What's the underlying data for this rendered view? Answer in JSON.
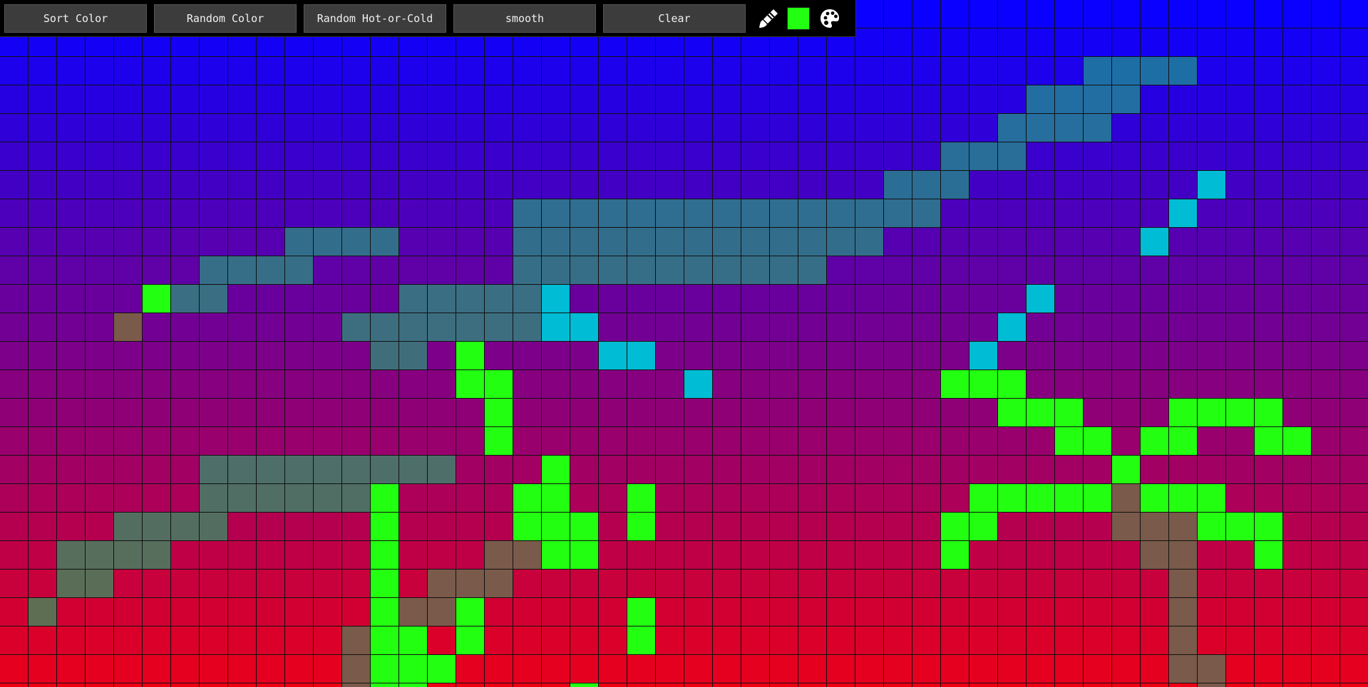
{
  "toolbar": {
    "buttons": [
      {
        "name": "sort-color-button",
        "label": "Sort Color"
      },
      {
        "name": "random-color-button",
        "label": "Random Color"
      },
      {
        "name": "random-hot-or-cold-button",
        "label": "Random Hot-or-Cold"
      },
      {
        "name": "smooth-button",
        "label": "smooth"
      },
      {
        "name": "clear-button",
        "label": "Clear"
      }
    ],
    "icons": {
      "brush": "paintbrush-icon",
      "palette": "palette-icon"
    },
    "current_color": "#22ff11"
  },
  "grid": {
    "columns": 48,
    "rows": 25,
    "top_color": "#0a00ff",
    "bottom_color": "#ee0015",
    "green": "#22ff11",
    "brown": "#7a5a4a",
    "cyan": "#00bcd4",
    "green_cells": [
      [
        10,
        5
      ],
      [
        12,
        16
      ],
      [
        13,
        16
      ],
      [
        13,
        17
      ],
      [
        14,
        17
      ],
      [
        15,
        17
      ],
      [
        17,
        18
      ],
      [
        18,
        18
      ],
      [
        18,
        19
      ],
      [
        19,
        19
      ],
      [
        16,
        19
      ],
      [
        17,
        19
      ],
      [
        18,
        20
      ],
      [
        19,
        20
      ],
      [
        17,
        22
      ],
      [
        18,
        22
      ],
      [
        21,
        22
      ],
      [
        22,
        22
      ],
      [
        17,
        13
      ],
      [
        18,
        13
      ],
      [
        19,
        13
      ],
      [
        20,
        13
      ],
      [
        21,
        13
      ],
      [
        22,
        13
      ],
      [
        23,
        13
      ],
      [
        24,
        13
      ],
      [
        25,
        13
      ],
      [
        22,
        14
      ],
      [
        23,
        14
      ],
      [
        24,
        14
      ],
      [
        25,
        14
      ],
      [
        23,
        15
      ],
      [
        21,
        16
      ],
      [
        22,
        16
      ],
      [
        24,
        20
      ],
      [
        25,
        20
      ],
      [
        13,
        33
      ],
      [
        13,
        34
      ],
      [
        13,
        35
      ],
      [
        14,
        35
      ],
      [
        14,
        36
      ],
      [
        14,
        37
      ],
      [
        15,
        37
      ],
      [
        15,
        38
      ],
      [
        14,
        41
      ],
      [
        14,
        42
      ],
      [
        14,
        43
      ],
      [
        14,
        44
      ],
      [
        15,
        40
      ],
      [
        15,
        41
      ],
      [
        15,
        44
      ],
      [
        15,
        45
      ],
      [
        16,
        39
      ],
      [
        17,
        34
      ],
      [
        17,
        35
      ],
      [
        17,
        36
      ],
      [
        17,
        37
      ],
      [
        17,
        38
      ],
      [
        17,
        40
      ],
      [
        17,
        41
      ],
      [
        17,
        42
      ],
      [
        18,
        33
      ],
      [
        18,
        34
      ],
      [
        18,
        42
      ],
      [
        18,
        43
      ],
      [
        18,
        44
      ],
      [
        19,
        33
      ],
      [
        19,
        44
      ]
    ],
    "brown_cells": [
      [
        19,
        17
      ],
      [
        19,
        18
      ],
      [
        19,
        19
      ],
      [
        20,
        15
      ],
      [
        20,
        16
      ],
      [
        20,
        17
      ],
      [
        21,
        13
      ],
      [
        21,
        14
      ],
      [
        21,
        15
      ],
      [
        22,
        12
      ],
      [
        22,
        13
      ],
      [
        22,
        14
      ],
      [
        23,
        12
      ],
      [
        23,
        13
      ],
      [
        24,
        12
      ],
      [
        17,
        39
      ],
      [
        18,
        39
      ],
      [
        18,
        40
      ],
      [
        18,
        41
      ],
      [
        19,
        40
      ],
      [
        19,
        41
      ],
      [
        20,
        41
      ],
      [
        21,
        41
      ],
      [
        22,
        41
      ],
      [
        23,
        41
      ],
      [
        23,
        42
      ],
      [
        24,
        42
      ],
      [
        11,
        4
      ]
    ],
    "cyan_cells": [
      [
        10,
        19
      ],
      [
        11,
        19
      ],
      [
        11,
        20
      ],
      [
        12,
        21
      ],
      [
        12,
        22
      ],
      [
        13,
        24
      ],
      [
        6,
        42
      ],
      [
        7,
        41
      ],
      [
        8,
        40
      ],
      [
        10,
        36
      ],
      [
        11,
        35
      ],
      [
        12,
        34
      ]
    ],
    "teal_cells": [
      [
        2,
        38
      ],
      [
        2,
        39
      ],
      [
        2,
        40
      ],
      [
        2,
        41
      ],
      [
        3,
        36
      ],
      [
        3,
        37
      ],
      [
        3,
        38
      ],
      [
        3,
        39
      ],
      [
        4,
        35
      ],
      [
        4,
        36
      ],
      [
        4,
        37
      ],
      [
        4,
        38
      ],
      [
        5,
        33
      ],
      [
        5,
        34
      ],
      [
        5,
        35
      ],
      [
        6,
        31
      ],
      [
        6,
        32
      ],
      [
        6,
        33
      ],
      [
        7,
        30
      ],
      [
        7,
        31
      ],
      [
        7,
        32
      ],
      [
        7,
        18
      ],
      [
        7,
        19
      ],
      [
        7,
        20
      ],
      [
        7,
        21
      ],
      [
        7,
        22
      ],
      [
        7,
        23
      ],
      [
        7,
        24
      ],
      [
        7,
        25
      ],
      [
        7,
        26
      ],
      [
        7,
        27
      ],
      [
        7,
        28
      ],
      [
        7,
        29
      ],
      [
        8,
        10
      ],
      [
        8,
        11
      ],
      [
        8,
        12
      ],
      [
        8,
        13
      ],
      [
        8,
        18
      ],
      [
        8,
        19
      ],
      [
        8,
        20
      ],
      [
        8,
        21
      ],
      [
        8,
        22
      ],
      [
        8,
        23
      ],
      [
        8,
        24
      ],
      [
        8,
        25
      ],
      [
        8,
        26
      ],
      [
        8,
        27
      ],
      [
        8,
        28
      ],
      [
        8,
        29
      ],
      [
        8,
        30
      ],
      [
        9,
        7
      ],
      [
        9,
        8
      ],
      [
        9,
        9
      ],
      [
        9,
        10
      ],
      [
        9,
        18
      ],
      [
        9,
        19
      ],
      [
        9,
        20
      ],
      [
        9,
        21
      ],
      [
        9,
        22
      ],
      [
        9,
        23
      ],
      [
        9,
        24
      ],
      [
        9,
        25
      ],
      [
        9,
        26
      ],
      [
        9,
        27
      ],
      [
        9,
        28
      ],
      [
        10,
        6
      ],
      [
        10,
        7
      ],
      [
        10,
        14
      ],
      [
        10,
        15
      ],
      [
        10,
        16
      ],
      [
        10,
        17
      ],
      [
        10,
        18
      ],
      [
        11,
        12
      ],
      [
        11,
        13
      ],
      [
        11,
        14
      ],
      [
        11,
        15
      ],
      [
        11,
        16
      ],
      [
        11,
        17
      ],
      [
        11,
        18
      ],
      [
        12,
        13
      ],
      [
        12,
        14
      ],
      [
        16,
        7
      ],
      [
        16,
        8
      ],
      [
        16,
        9
      ],
      [
        16,
        10
      ],
      [
        16,
        11
      ],
      [
        16,
        12
      ],
      [
        16,
        13
      ],
      [
        16,
        14
      ],
      [
        16,
        15
      ],
      [
        17,
        7
      ],
      [
        17,
        8
      ],
      [
        17,
        9
      ],
      [
        17,
        10
      ],
      [
        17,
        11
      ],
      [
        17,
        12
      ],
      [
        18,
        4
      ],
      [
        18,
        5
      ],
      [
        18,
        6
      ],
      [
        18,
        7
      ],
      [
        19,
        2
      ],
      [
        19,
        3
      ],
      [
        19,
        4
      ],
      [
        19,
        5
      ],
      [
        20,
        2
      ],
      [
        20,
        3
      ],
      [
        21,
        1
      ]
    ]
  }
}
